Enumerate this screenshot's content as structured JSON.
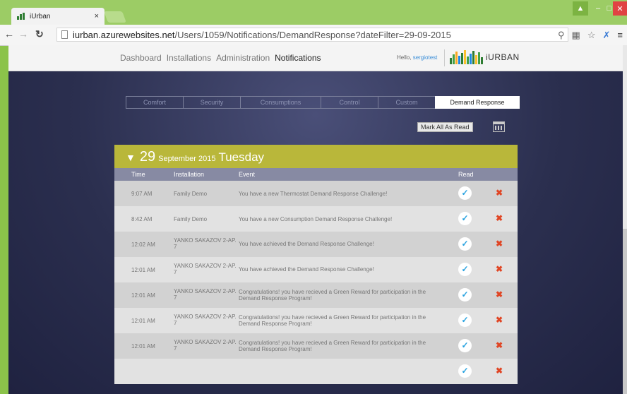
{
  "browser": {
    "tab_title": "iUrban",
    "tab_close": "×",
    "url_host": "iurban.azurewebsites.net",
    "url_path": "/Users/1059/Notifications/DemandResponse?dateFilter=29-09-2015"
  },
  "nav": {
    "items": [
      "Dashboard",
      "Installations",
      "Administration",
      "Notifications"
    ],
    "active": "Notifications",
    "hello_label": "Hello,",
    "username": "sergiotest",
    "logo_text": "iURBAN"
  },
  "tabs": [
    {
      "label": "Comfort",
      "width": 82
    },
    {
      "label": "Security",
      "width": 82
    },
    {
      "label": "Consumptions",
      "width": 115
    },
    {
      "label": "Control",
      "width": 82
    },
    {
      "label": "Custom",
      "width": 82
    },
    {
      "label": "Demand Response",
      "width": 120
    }
  ],
  "active_tab": "Demand Response",
  "mark_all_label": "Mark All As Read",
  "day": {
    "day_num": "29",
    "month_year": "September 2015",
    "weekday": "Tuesday"
  },
  "columns": {
    "time": "Time",
    "installation": "Installation",
    "event": "Event",
    "read": "Read"
  },
  "notifications": [
    {
      "time": "9:07 AM",
      "installation": "Family Demo",
      "event": "You have a new Thermostat Demand Response Challenge!"
    },
    {
      "time": "8:42 AM",
      "installation": "Family Demo",
      "event": "You have a new Consumption Demand Response Challenge!"
    },
    {
      "time": "12:02 AM",
      "installation": "YANKO SAKAZOV 2-AP. 7",
      "event": "You have achieved the Demand Response Challenge!"
    },
    {
      "time": "12:01 AM",
      "installation": "YANKO SAKAZOV 2-AP. 7",
      "event": "You have achieved the Demand Response Challenge!"
    },
    {
      "time": "12:01 AM",
      "installation": "YANKO SAKAZOV 2-AP. 7",
      "event": "Congratulations! you have recieved a Green Reward for participation in the Demand Response Program!"
    },
    {
      "time": "12:01 AM",
      "installation": "YANKO SAKAZOV 2-AP. 7",
      "event": "Congratulations! you have recieved a Green Reward for participation in the Demand Response Program!"
    },
    {
      "time": "12:01 AM",
      "installation": "YANKO SAKAZOV 2-AP. 7",
      "event": "Congratulations! you have recieved a Green Reward for participation in the Demand Response Program!"
    },
    {
      "time": "",
      "installation": "",
      "event": ""
    }
  ],
  "colors": {
    "day_header": "#b9b73a",
    "column_header": "#878aa3",
    "check": "#2aa3e0",
    "delete": "#e04524"
  }
}
